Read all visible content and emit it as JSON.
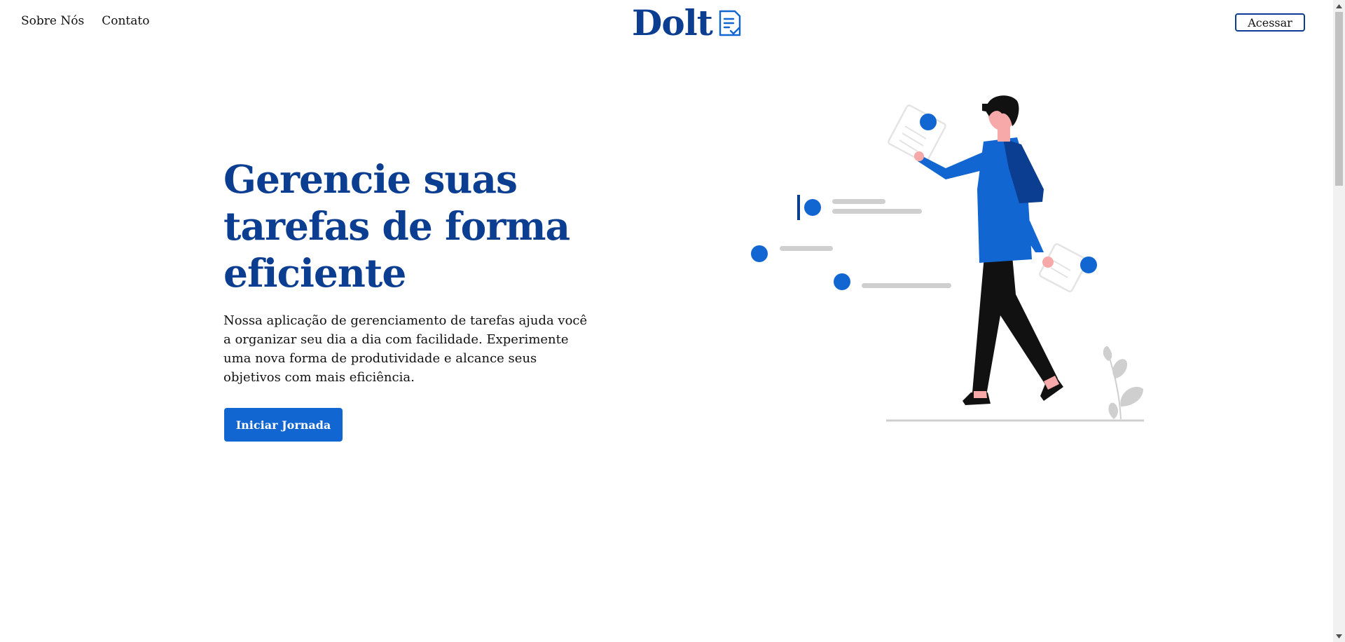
{
  "nav": {
    "items": [
      {
        "label": "Sobre Nós"
      },
      {
        "label": "Contato"
      }
    ]
  },
  "logo": {
    "text": "Dolt",
    "icon": "checklist-document-icon"
  },
  "header": {
    "access_label": "Acessar"
  },
  "hero": {
    "title": "Gerencie suas tarefas de forma eficiente",
    "description": "Nossa aplicação de gerenciamento de tarefas ajuda você a organizar seu dia a dia com facilidade. Experimente uma nova forma de produtividade e alcance seus objetivos com mais eficiência.",
    "cta_label": "Iniciar Jornada"
  },
  "colors": {
    "brand_dark": "#0b3d91",
    "brand_blue": "#1266d1",
    "gray_line": "#cfcfcf"
  }
}
